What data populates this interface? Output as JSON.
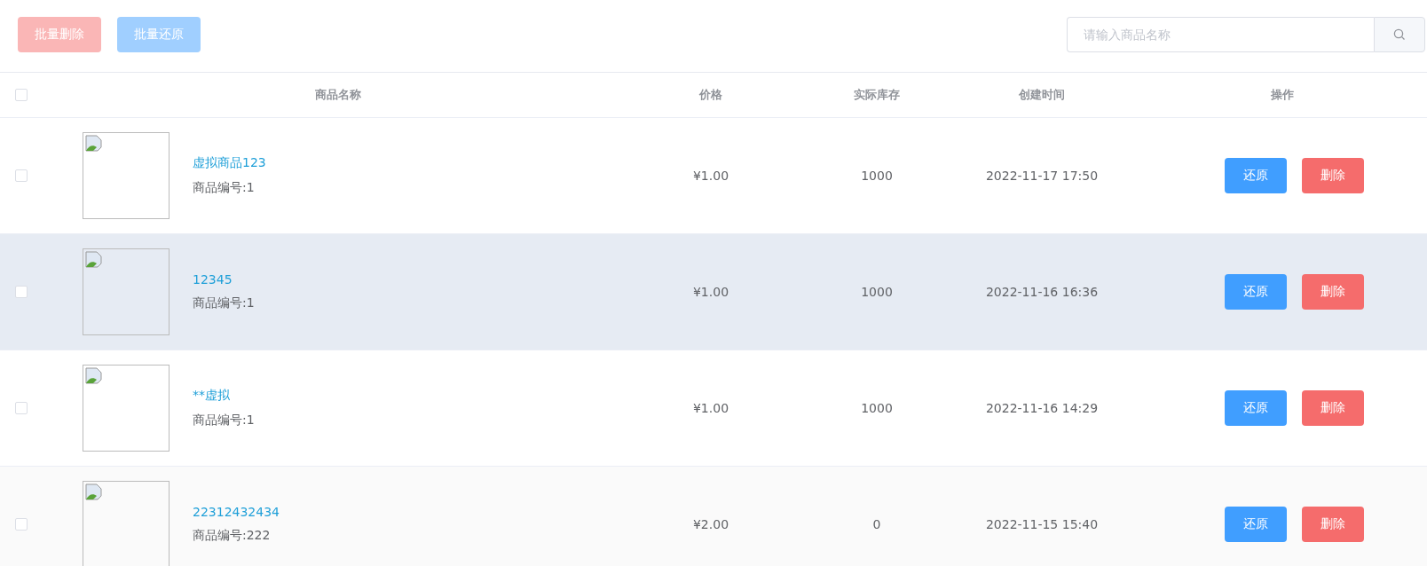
{
  "toolbar": {
    "buttons": [
      {
        "label": "批量删除",
        "kind": "danger",
        "disabled": true
      },
      {
        "label": "批量还原",
        "kind": "primary",
        "disabled": true
      }
    ],
    "search": {
      "placeholder": "请输入商品名称"
    }
  },
  "table": {
    "select_all": {
      "checked": false
    },
    "columns": [
      "商品名称",
      "价格",
      "实际库存",
      "创建时间",
      "操作"
    ],
    "rows": [
      {
        "selected": false,
        "hovered": false,
        "name": "虚拟商品123",
        "code": "商品编号:1",
        "price": "¥1.00",
        "stock": "1000",
        "created": "2022-11-17 17:50",
        "actions": [
          {
            "label": "还原",
            "kind": "primary"
          },
          {
            "label": "删除",
            "kind": "danger"
          }
        ]
      },
      {
        "selected": false,
        "hovered": true,
        "name": "12345",
        "code": "商品编号:1",
        "price": "¥1.00",
        "stock": "1000",
        "created": "2022-11-16 16:36",
        "actions": [
          {
            "label": "还原",
            "kind": "primary"
          },
          {
            "label": "删除",
            "kind": "danger"
          }
        ]
      },
      {
        "selected": false,
        "hovered": false,
        "name": "**虚拟",
        "code": "商品编号:1",
        "price": "¥1.00",
        "stock": "1000",
        "created": "2022-11-16 14:29",
        "actions": [
          {
            "label": "还原",
            "kind": "primary"
          },
          {
            "label": "删除",
            "kind": "danger"
          }
        ]
      },
      {
        "selected": false,
        "hovered": false,
        "name": "22312432434",
        "code": "商品编号:222",
        "price": "¥2.00",
        "stock": "0",
        "created": "2022-11-15 15:40",
        "actions": [
          {
            "label": "还原",
            "kind": "primary"
          },
          {
            "label": "删除",
            "kind": "danger"
          }
        ]
      }
    ]
  }
}
